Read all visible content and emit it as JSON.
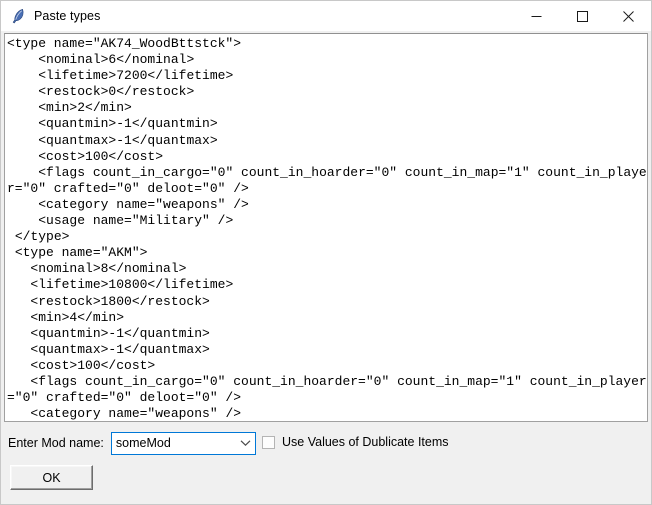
{
  "window": {
    "title": "Paste types",
    "icon": "feather-quill-icon",
    "controls": {
      "minimize": "minimize-icon",
      "maximize": "maximize-icon",
      "close": "close-icon"
    }
  },
  "editor": {
    "content": "<type name=\"AK74_WoodBttstck\">\n    <nominal>6</nominal>\n    <lifetime>7200</lifetime>\n    <restock>0</restock>\n    <min>2</min>\n    <quantmin>-1</quantmin>\n    <quantmax>-1</quantmax>\n    <cost>100</cost>\n    <flags count_in_cargo=\"0\" count_in_hoarder=\"0\" count_in_map=\"1\" count_in_player=\"0\" crafted=\"0\" deloot=\"0\" />\n    <category name=\"weapons\" />\n    <usage name=\"Military\" />\n </type>\n <type name=\"AKM\">\n   <nominal>8</nominal>\n   <lifetime>10800</lifetime>\n   <restock>1800</restock>\n   <min>4</min>\n   <quantmin>-1</quantmin>\n   <quantmax>-1</quantmax>\n   <cost>100</cost>\n   <flags count_in_cargo=\"0\" count_in_hoarder=\"0\" count_in_map=\"1\" count_in_player=\"0\" crafted=\"0\" deloot=\"0\" />\n   <category name=\"weapons\" />"
  },
  "form": {
    "modname_label": "Enter Mod name:",
    "modname_value": "someMod",
    "modname_arrow_icon": "chevron-down-icon",
    "duplicate_checkbox_label": "Use Values of Dublicate Items",
    "duplicate_checkbox_checked": false,
    "ok_label": "OK"
  },
  "colors": {
    "focus_border": "#0078d7",
    "window_background": "#f0f0f0",
    "editor_background": "#ffffff",
    "icon_blue": "#4a6fb5"
  }
}
